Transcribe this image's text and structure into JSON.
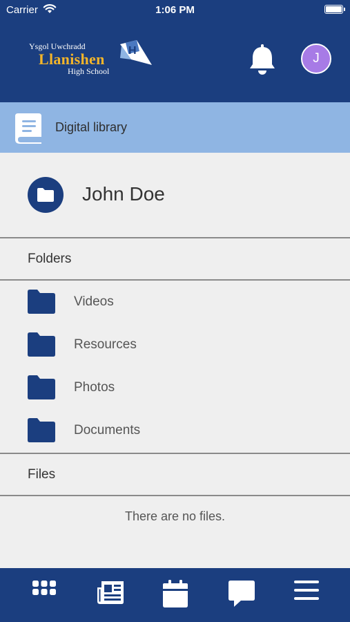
{
  "status_bar": {
    "carrier": "Carrier",
    "time": "1:06 PM"
  },
  "header": {
    "logo": {
      "line1": "Ysgol Uwchradd",
      "line2": "Llanishen",
      "line3": "High School",
      "mark": "H"
    },
    "icons": {
      "notifications": "bell-icon"
    },
    "avatar_initial": "J",
    "avatar_color": "#a77be6",
    "brand_color": "#1b3e7f"
  },
  "library": {
    "title": "Digital library",
    "band_color": "#8fb5e3"
  },
  "owner": {
    "name": "John Doe"
  },
  "folders": {
    "heading": "Folders",
    "items": [
      {
        "label": "Videos"
      },
      {
        "label": "Resources"
      },
      {
        "label": "Photos"
      },
      {
        "label": "Documents"
      }
    ]
  },
  "files": {
    "heading": "Files",
    "empty_message": "There are no files."
  },
  "bottom_nav": {
    "items": [
      {
        "icon": "apps-grid-icon"
      },
      {
        "icon": "newspaper-icon"
      },
      {
        "icon": "calendar-icon"
      },
      {
        "icon": "chat-icon"
      },
      {
        "icon": "menu-icon"
      }
    ]
  }
}
